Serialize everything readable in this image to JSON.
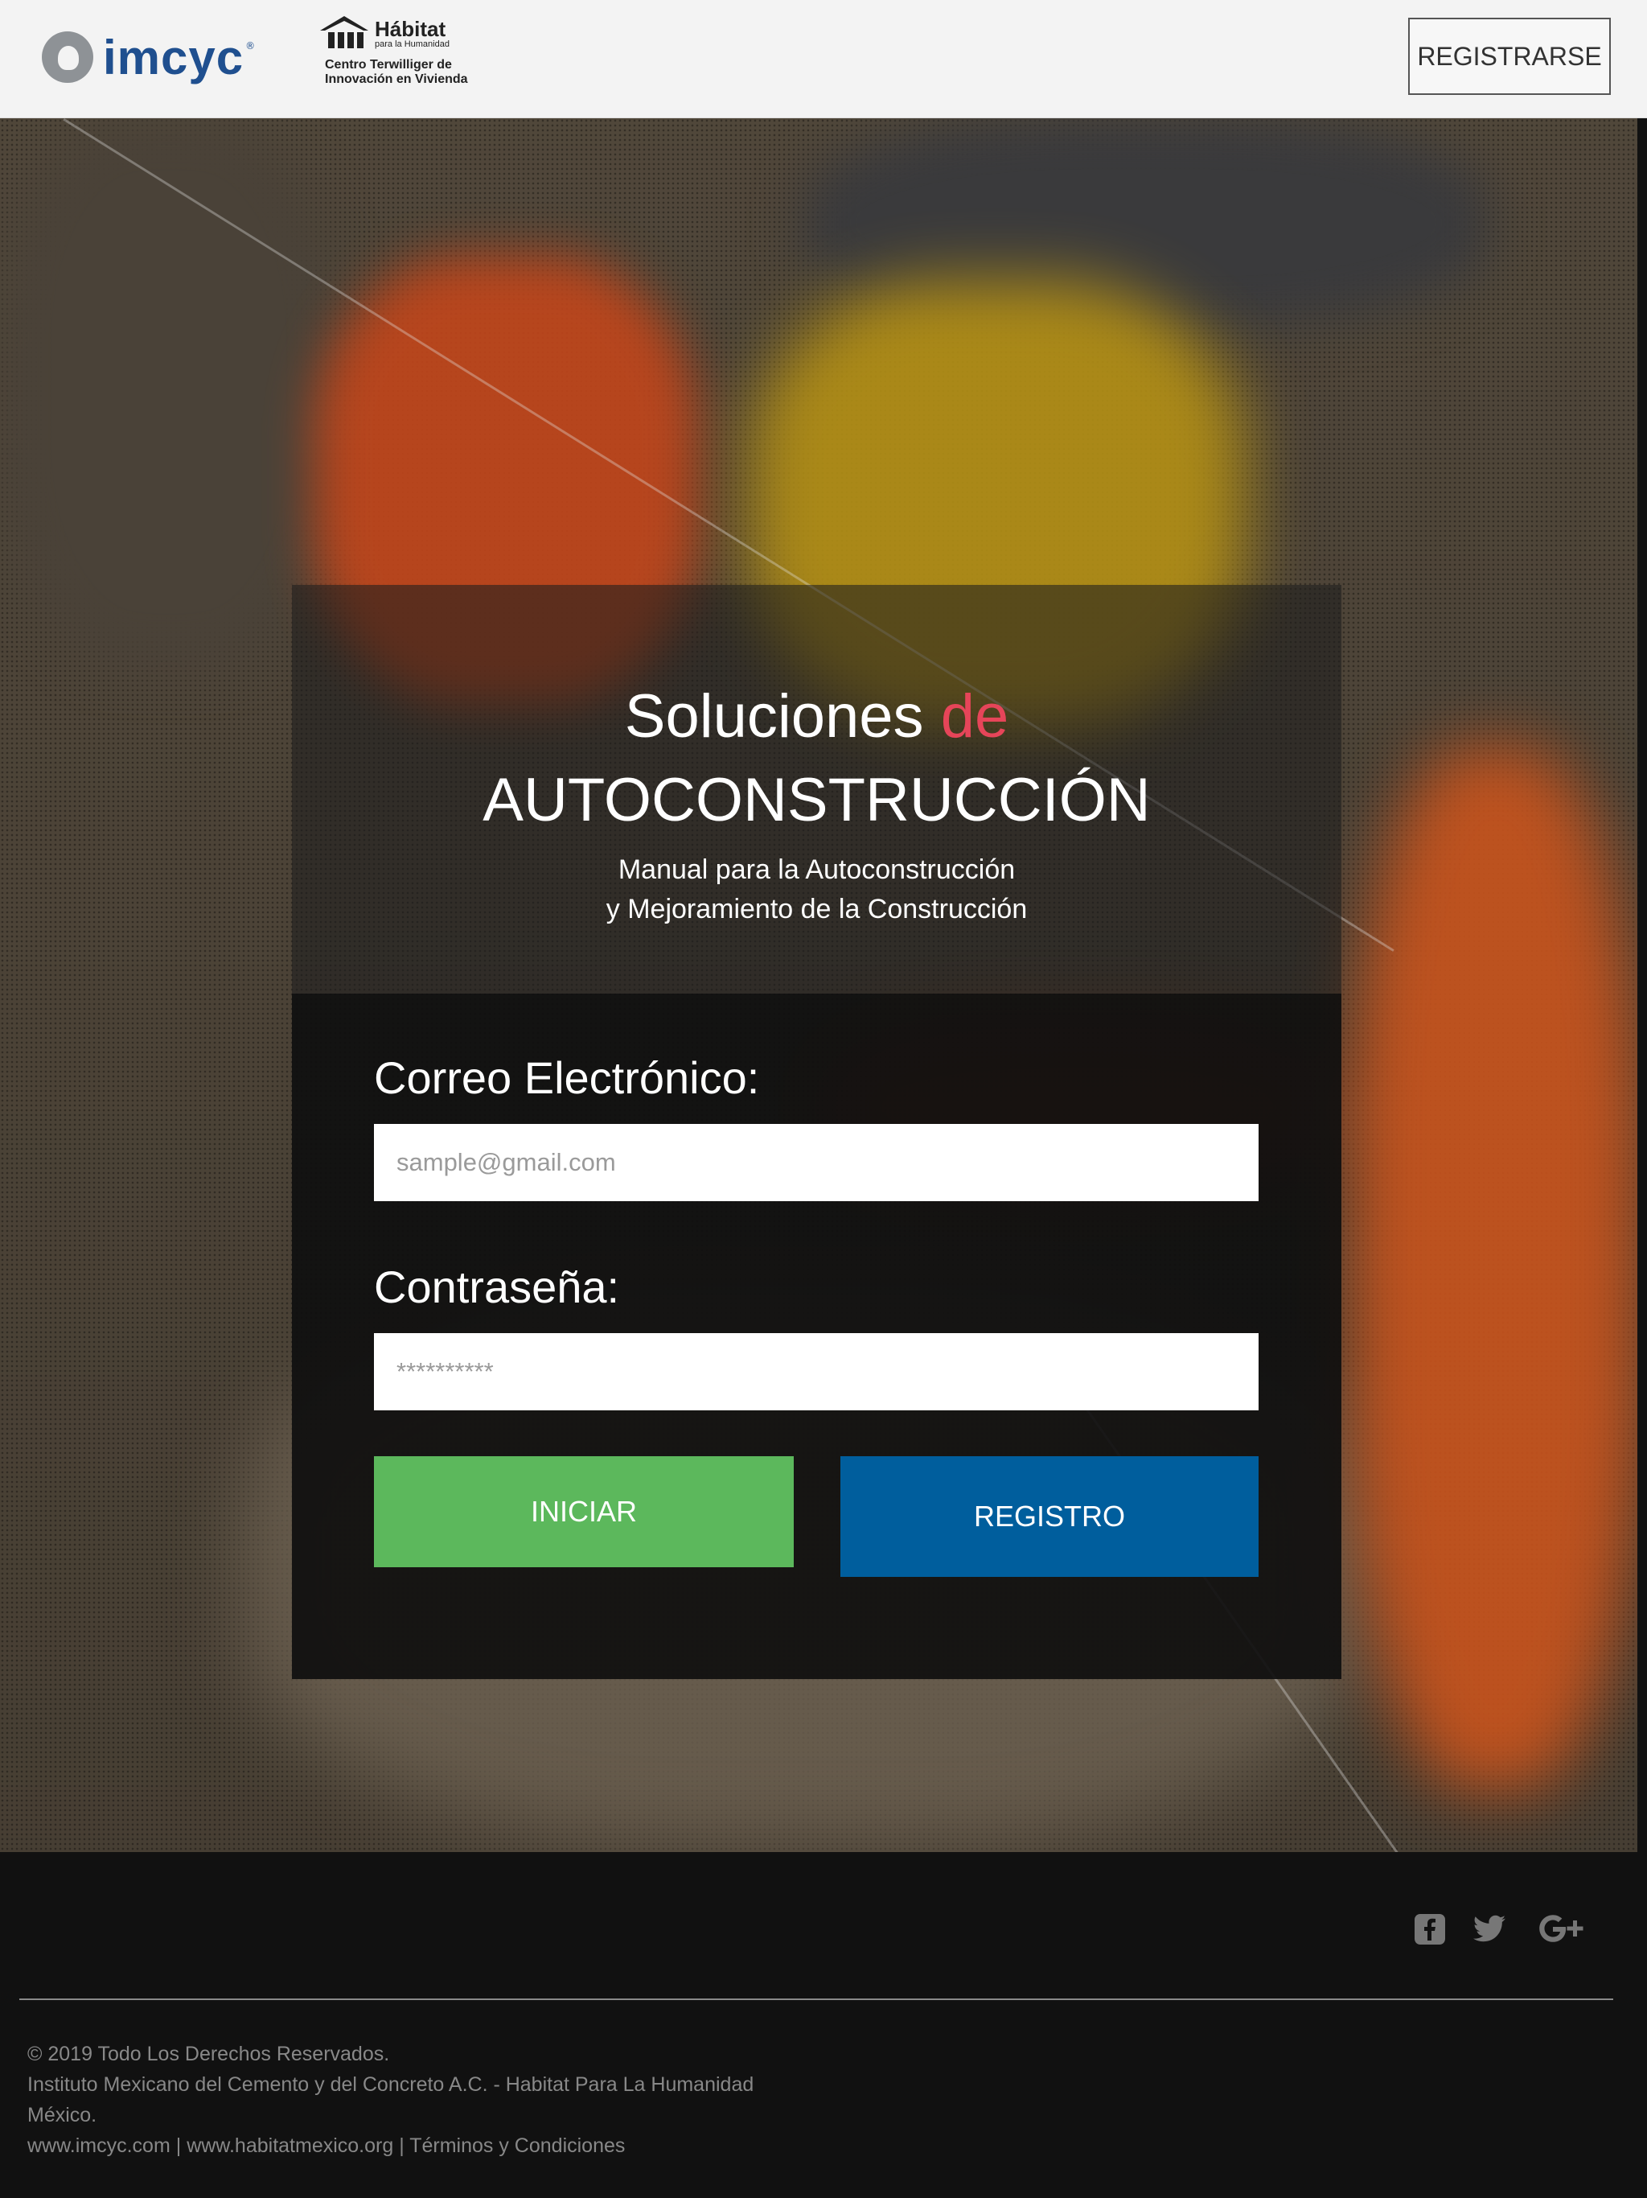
{
  "header": {
    "logo_imcyc_text": "imcyc",
    "logo_habitat_name": "Hábitat",
    "logo_habitat_sub": "para la Humanidad",
    "logo_habitat_caption_1": "Centro Terwilliger de",
    "logo_habitat_caption_2": "Innovación en Vivienda",
    "register_button": "REGISTRARSE"
  },
  "hero": {
    "title_word": "Soluciones",
    "title_accent": "de",
    "title_line2": "AUTOCONSTRUCCIÓN",
    "subtitle_line1": "Manual para la Autoconstrucción",
    "subtitle_line2": "y Mejoramiento de la Construcción",
    "accent_color": "#e64559"
  },
  "form": {
    "email_label": "Correo Electrónico:",
    "email_placeholder": "sample@gmail.com",
    "password_label": "Contraseña:",
    "password_placeholder": "**********",
    "login_button": "INICIAR",
    "register_button": "REGISTRO",
    "login_color": "#5cb85c",
    "register_color": "#005e9d"
  },
  "footer": {
    "social": [
      "facebook-icon",
      "twitter-icon",
      "google-plus-icon"
    ],
    "copyright": "© 2019 Todo Los Derechos Reservados.",
    "org_line": "Instituto Mexicano del Cemento y del Concreto A.C. - Habitat Para La Humanidad",
    "country": "México.",
    "link_imcyc": "www.imcyc.com",
    "link_habitat": "www.habitatmexico.org",
    "link_terms": "Términos y Condiciones",
    "separator": "|"
  }
}
